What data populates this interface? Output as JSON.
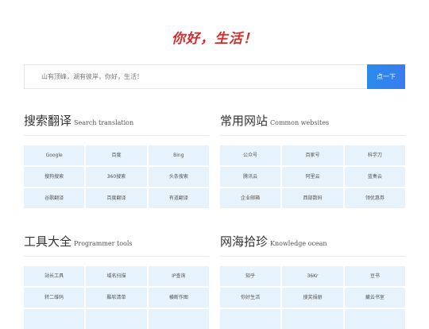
{
  "logo": {
    "text": "你好，生活！"
  },
  "search": {
    "placeholder": "山有顶峰，湖有彼岸，你好，生活！",
    "button_label": "点一下"
  },
  "sections": {
    "search_translation": {
      "title": "搜索翻译",
      "subtitle": "Search translation",
      "items": [
        "Google",
        "百度",
        "Bing",
        "搜狗搜索",
        "360搜索",
        "头条搜索",
        "谷歌翻译",
        "百度翻译",
        "有道翻译"
      ]
    },
    "common_websites": {
      "title": "常用网站",
      "subtitle": "Common websites",
      "items": [
        "公众号",
        "百家号",
        "科学刀",
        "腾讯云",
        "阿里云",
        "蓝奏云",
        "企业邮箱",
        "西部数码",
        "领优惠券"
      ]
    },
    "programmer_tools": {
      "title": "工具大全",
      "subtitle": "Programmer tools",
      "items": [
        "站长工具",
        "域名扫描",
        "IP查询",
        "转二维码",
        "酷软清单",
        "横断作图",
        "",
        "",
        ""
      ]
    },
    "knowledge_ocean": {
      "title": "网海拾珍",
      "subtitle": "Knowledge ocean",
      "items": [
        "知乎",
        "36Kr",
        "豆书",
        "你好生活",
        "搜奖捐册",
        "藏云书室",
        "",
        "",
        ""
      ]
    }
  }
}
